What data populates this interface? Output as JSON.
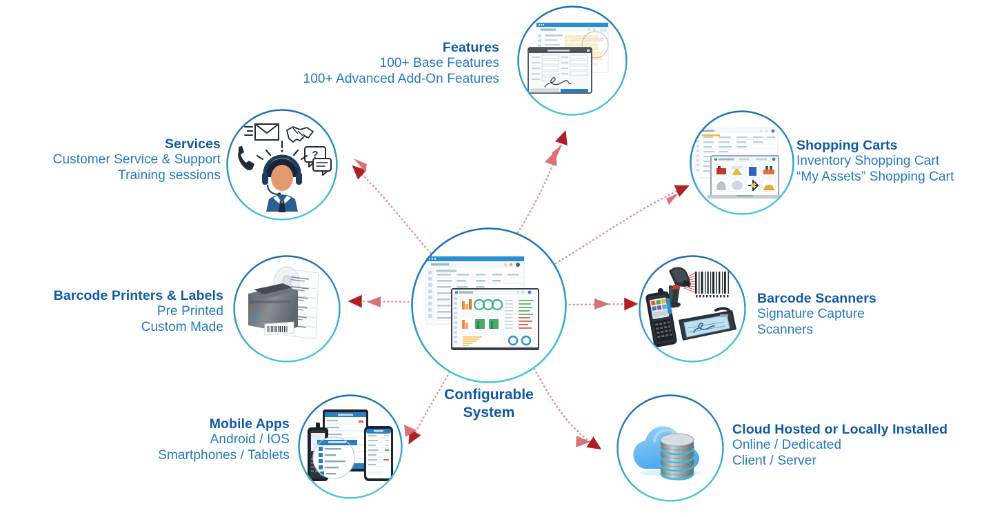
{
  "diagram": {
    "center": {
      "caption_line1": "Configurable",
      "caption_line2": "System",
      "art": "app-dashboard-screenshots"
    },
    "accent_colors": {
      "title_blue": "#1059a6",
      "body_blue": "#2279bd",
      "ring_top": "#1565b0",
      "ring_bottom": "#45c3de",
      "arrow_dark_red": "#b01f24",
      "arrow_light_red": "#d9717a",
      "arrow_dotted": "#e0919a"
    },
    "nodes": [
      {
        "id": "features",
        "title": "Features",
        "lines": [
          "100+ Base Features",
          "100+ Advanced Add-On Features"
        ],
        "align": "right",
        "art": "app-signature-dialog-screenshot"
      },
      {
        "id": "services",
        "title": "Services",
        "lines": [
          "Customer Service & Support",
          "Training sessions"
        ],
        "align": "right",
        "art": "support-agent-headset-icon"
      },
      {
        "id": "shopping-carts",
        "title": "Shopping Carts",
        "lines": [
          "Inventory Shopping Cart",
          "“My Assets” Shopping Cart"
        ],
        "align": "left",
        "art": "laptop-product-catalog-screenshot"
      },
      {
        "id": "barcode-printers",
        "title": "Barcode Printers & Labels",
        "lines": [
          "Pre Printed",
          "Custom Made"
        ],
        "align": "right",
        "art": "label-printer-and-label-roll"
      },
      {
        "id": "barcode-scanners",
        "title": "Barcode Scanners",
        "lines": [
          "Signature Capture",
          "Scanners"
        ],
        "align": "left",
        "art": "barcode-scanner-handheld-signature-pad"
      },
      {
        "id": "mobile-apps",
        "title": "Mobile Apps",
        "lines": [
          "Android / IOS",
          "Smartphones / Tablets"
        ],
        "align": "right",
        "art": "tablet-phone-rugged-device"
      },
      {
        "id": "cloud",
        "title": "Cloud Hosted or Locally Installed",
        "lines": [
          "Online / Dedicated",
          "Client / Server"
        ],
        "align": "left",
        "art": "cloud-database-icon"
      }
    ]
  }
}
